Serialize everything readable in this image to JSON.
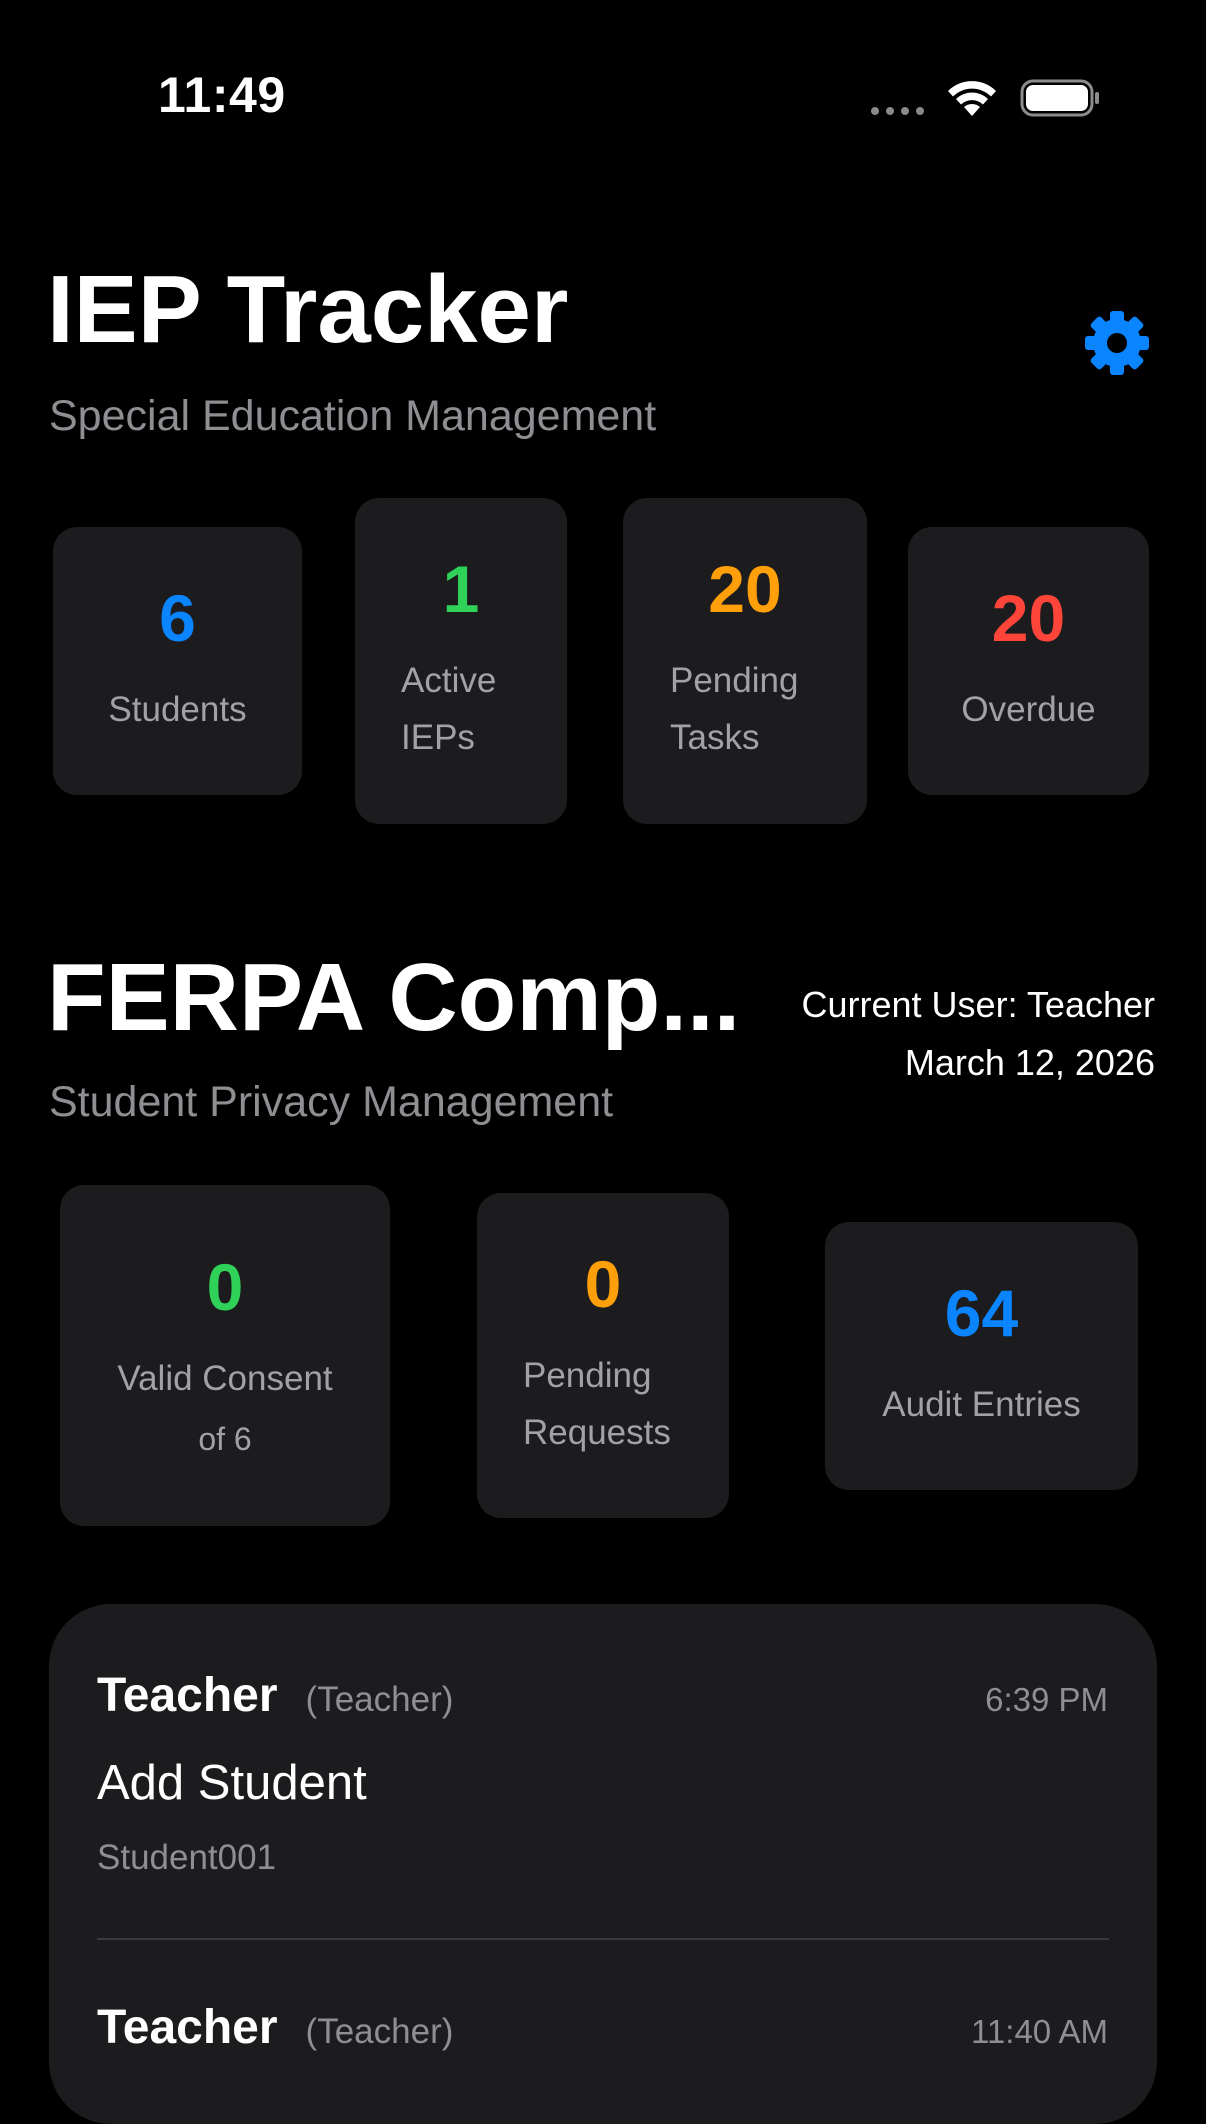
{
  "status_bar": {
    "time": "11:49"
  },
  "iep": {
    "title": "IEP Tracker",
    "subtitle": "Special Education Management",
    "settings_icon": "gear-icon",
    "stats": [
      {
        "value": "6",
        "label": "Students",
        "color": "#0a84ff"
      },
      {
        "value": "1",
        "label": "Active IEPs",
        "color": "#30d158"
      },
      {
        "value": "20",
        "label": "Pending Tasks",
        "color": "#ff9f0a"
      },
      {
        "value": "20",
        "label": "Overdue",
        "color": "#ff453a"
      }
    ]
  },
  "ferpa": {
    "title": "FERPA Comp...",
    "subtitle": "Student Privacy Management",
    "current_user": "Current User: Teacher",
    "date": "March 12, 2026",
    "stats": [
      {
        "value": "0",
        "label": "Valid Consent",
        "sub": "of 6",
        "color": "#30d158"
      },
      {
        "value": "0",
        "label": "Pending Requests",
        "color": "#ff9f0a"
      },
      {
        "value": "64",
        "label": "Audit Entries",
        "color": "#0a84ff"
      }
    ]
  },
  "audit_log": [
    {
      "actor": "Teacher",
      "role": "(Teacher)",
      "time": "6:39 PM",
      "action": "Add Student",
      "target": "Student001"
    },
    {
      "actor": "Teacher",
      "role": "(Teacher)",
      "time": "11:40 AM"
    }
  ],
  "colors": {
    "background": "#000000",
    "card": "#1c1c1e",
    "accent_blue": "#0a84ff",
    "green": "#30d158",
    "orange": "#ff9f0a",
    "red": "#ff453a"
  }
}
